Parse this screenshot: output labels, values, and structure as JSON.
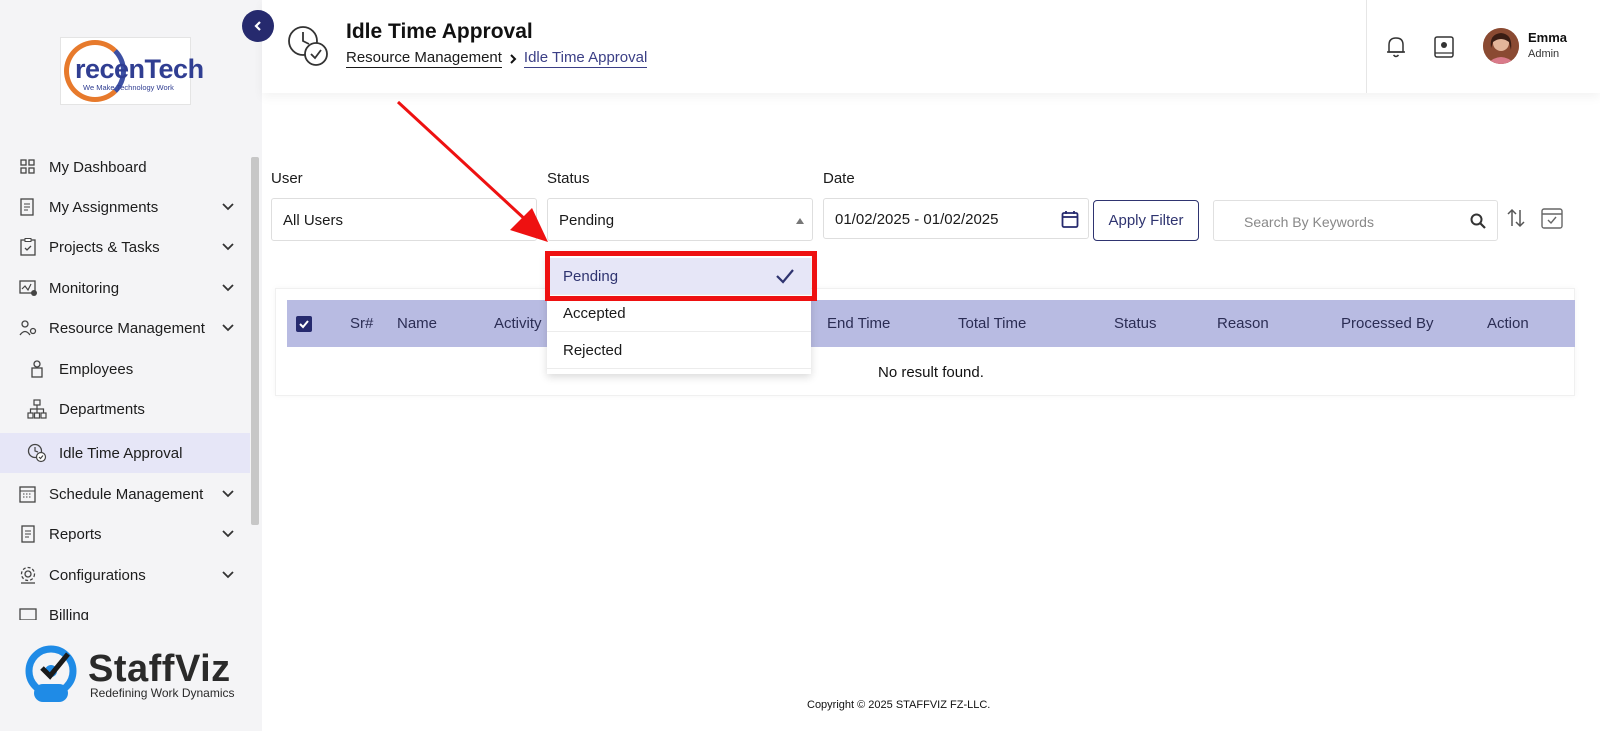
{
  "sidebar": {
    "logo": {
      "text": "recenTech",
      "tagline": "We Make Technology Work"
    },
    "items": [
      {
        "label": "My Dashboard",
        "icon": "dashboard-icon",
        "chevron": false
      },
      {
        "label": "My Assignments",
        "icon": "assignments-icon",
        "chevron": true
      },
      {
        "label": "Projects & Tasks",
        "icon": "clipboard-icon",
        "chevron": true
      },
      {
        "label": "Monitoring",
        "icon": "monitor-icon",
        "chevron": true
      },
      {
        "label": "Resource Management",
        "icon": "users-gear-icon",
        "chevron": true
      },
      {
        "label": "Employees",
        "icon": "employee-icon",
        "chevron": false,
        "sub": true
      },
      {
        "label": "Departments",
        "icon": "org-chart-icon",
        "chevron": false,
        "sub": true
      },
      {
        "label": "Idle Time Approval",
        "icon": "clock-check-icon",
        "chevron": false,
        "sub": true,
        "active": true
      },
      {
        "label": "Schedule Management",
        "icon": "calendar-icon",
        "chevron": true
      },
      {
        "label": "Reports",
        "icon": "report-icon",
        "chevron": true
      },
      {
        "label": "Configurations",
        "icon": "config-gear-icon",
        "chevron": true
      },
      {
        "label": "Billing",
        "icon": "billing-icon",
        "chevron": false
      }
    ],
    "brand": {
      "name": "StaffViz",
      "tagline": "Redefining Work Dynamics"
    }
  },
  "header": {
    "title": "Idle Time Approval",
    "breadcrumb": [
      "Resource Management",
      "Idle Time Approval"
    ],
    "user": {
      "name": "Emma",
      "role": "Admin"
    }
  },
  "filters": {
    "user": {
      "label": "User",
      "value": "All Users"
    },
    "status": {
      "label": "Status",
      "value": "Pending"
    },
    "date": {
      "label": "Date",
      "value": "01/02/2025 - 01/02/2025"
    },
    "apply_label": "Apply Filter",
    "search_placeholder": "Search By Keywords"
  },
  "status_dropdown": {
    "options": [
      "Pending",
      "Accepted",
      "Rejected"
    ],
    "selected": "Pending"
  },
  "table": {
    "columns": [
      "Sr#",
      "Name",
      "Activity",
      "",
      "",
      "End Time",
      "Total Time",
      "Status",
      "Reason",
      "Processed By",
      "Action"
    ],
    "empty_text": "No result found."
  },
  "footer": {
    "copyright": "Copyright © 2025 STAFFVIZ FZ-LLC."
  },
  "colors": {
    "accent": "#262a6e",
    "table_header": "#b8bbe2",
    "active_bg": "#e6e6f7",
    "annotation": "#ee1111",
    "logo_orange": "#e77a2c",
    "brand_blue": "#1f8be6"
  }
}
